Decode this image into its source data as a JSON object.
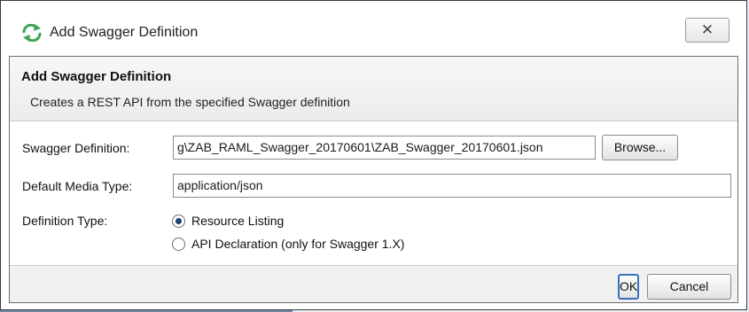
{
  "window": {
    "title": "Add Swagger Definition",
    "close_glyph": "✕"
  },
  "header": {
    "title": "Add Swagger Definition",
    "description": "Creates a REST API from the specified Swagger definition"
  },
  "form": {
    "swagger_definition_label": "Swagger Definition:",
    "swagger_definition_value": "g\\ZAB_RAML_Swagger_20170601\\ZAB_Swagger_20170601.json",
    "browse_label": "Browse...",
    "media_type_label": "Default Media Type:",
    "media_type_value": "application/json",
    "definition_type_label": "Definition Type:",
    "options": [
      {
        "label": "Resource Listing",
        "selected": true
      },
      {
        "label": "API Declaration (only for Swagger 1.X)",
        "selected": false
      }
    ]
  },
  "buttons": {
    "ok": "OK",
    "cancel": "Cancel"
  },
  "colors": {
    "icon_green": "#3aa655",
    "default_button_border": "#3b6fc1"
  },
  "icons": {
    "title_icon": "swagger-refresh-icon",
    "close_icon": "close-icon"
  }
}
